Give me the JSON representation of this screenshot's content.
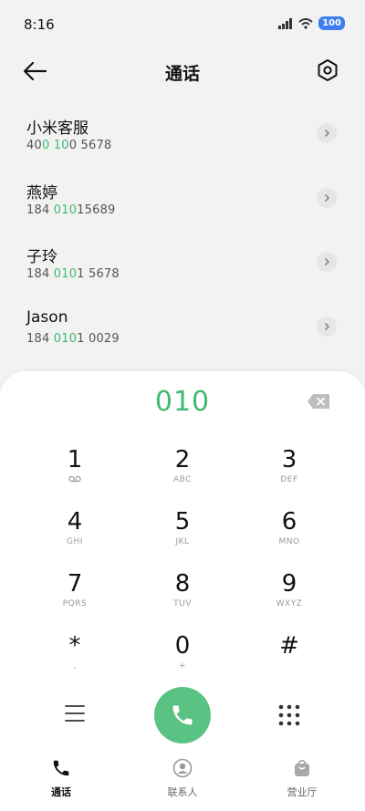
{
  "status": {
    "time": "8:16",
    "battery": "100"
  },
  "header": {
    "title": "通话"
  },
  "contacts": [
    {
      "name": "小米客服",
      "number_parts": [
        "40",
        "0 10",
        "0 5678"
      ]
    },
    {
      "name": "燕婷",
      "number_parts": [
        "184 ",
        "010",
        "15689"
      ]
    },
    {
      "name": "子玲",
      "number_parts": [
        "184 ",
        "010",
        "1 5678"
      ]
    },
    {
      "name": "Jason",
      "number_parts": [
        "184 ",
        "010",
        "1 0029"
      ]
    }
  ],
  "dialer": {
    "input": "010",
    "keys": [
      {
        "digit": "1",
        "letters": ""
      },
      {
        "digit": "2",
        "letters": "ABC"
      },
      {
        "digit": "3",
        "letters": "DEF"
      },
      {
        "digit": "4",
        "letters": "GHI"
      },
      {
        "digit": "5",
        "letters": "JKL"
      },
      {
        "digit": "6",
        "letters": "MNO"
      },
      {
        "digit": "7",
        "letters": "PQRS"
      },
      {
        "digit": "8",
        "letters": "TUV"
      },
      {
        "digit": "9",
        "letters": "WXYZ"
      },
      {
        "digit": "*",
        "letters": ","
      },
      {
        "digit": "0",
        "letters": "+"
      },
      {
        "digit": "#",
        "letters": ""
      }
    ]
  },
  "tabs": [
    {
      "label": "通话",
      "icon": "phone-icon",
      "active": true
    },
    {
      "label": "联系人",
      "icon": "person-icon",
      "active": false
    },
    {
      "label": "营业厅",
      "icon": "shopping-bag-icon",
      "active": false
    }
  ],
  "colors": {
    "accent": "#3fba6e",
    "call_button": "#5ac383",
    "battery": "#3d7ff0"
  }
}
